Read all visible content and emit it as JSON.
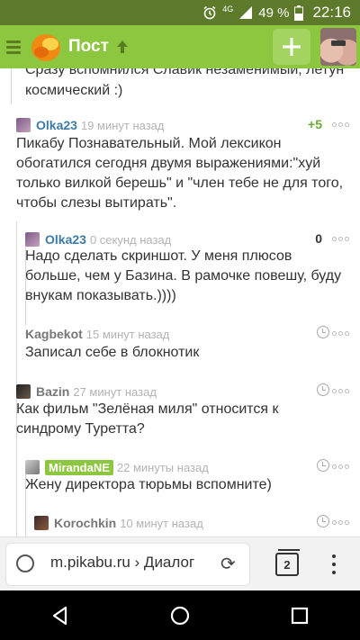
{
  "status_bar": {
    "network": "4G",
    "battery": "49 %",
    "time": "22:16",
    "icons": [
      "alarm-icon",
      "signal-icon",
      "battery-icon"
    ]
  },
  "app_bar": {
    "title": "Пост",
    "add_label": "+",
    "colors": {
      "bar": "#8dc63f",
      "status": "#5d7a2a"
    }
  },
  "feed": {
    "cut_text": "Сразу вспомнился Славик незаменимый, летун космический :)",
    "comments": [
      {
        "user": "Olka23",
        "time": "19 минут назад",
        "rating": "+5",
        "text": "Пикабу Познавательный. Мой лексикон обогатился сегодня двумя выражениями:\"хуй только вилкой берешь\" и \"член тебе не для того, чтобы слезы вытирать\"."
      },
      {
        "user": "Olka23",
        "time": "0 секунд назад",
        "rating": "0",
        "text": "Надо сделать скриншот. У меня плюсов больше, чем у Базина. В рамочке повешу, буду внукам показывать.))))"
      },
      {
        "user": "Kagbekot",
        "time": "15 минут назад",
        "text": "Записал себе в блокнотик"
      },
      {
        "user": "Bazin",
        "time": "27 минут назад",
        "text": "Как фильм \"Зелёная миля\" относится к синдрому Туретта?"
      },
      {
        "user": "MirandaNE",
        "time": "22 минуты назад",
        "text": "Жену директора тюрьмы вспомните)"
      },
      {
        "user": "Korochkin",
        "time": "10 минут назад",
        "text": ""
      }
    ]
  },
  "url_bar": {
    "url": "m.pikabu.ru › Диалог",
    "tab_count": "2"
  },
  "nav_bar": {
    "buttons": [
      "back-icon",
      "home-icon",
      "recents-icon"
    ]
  }
}
